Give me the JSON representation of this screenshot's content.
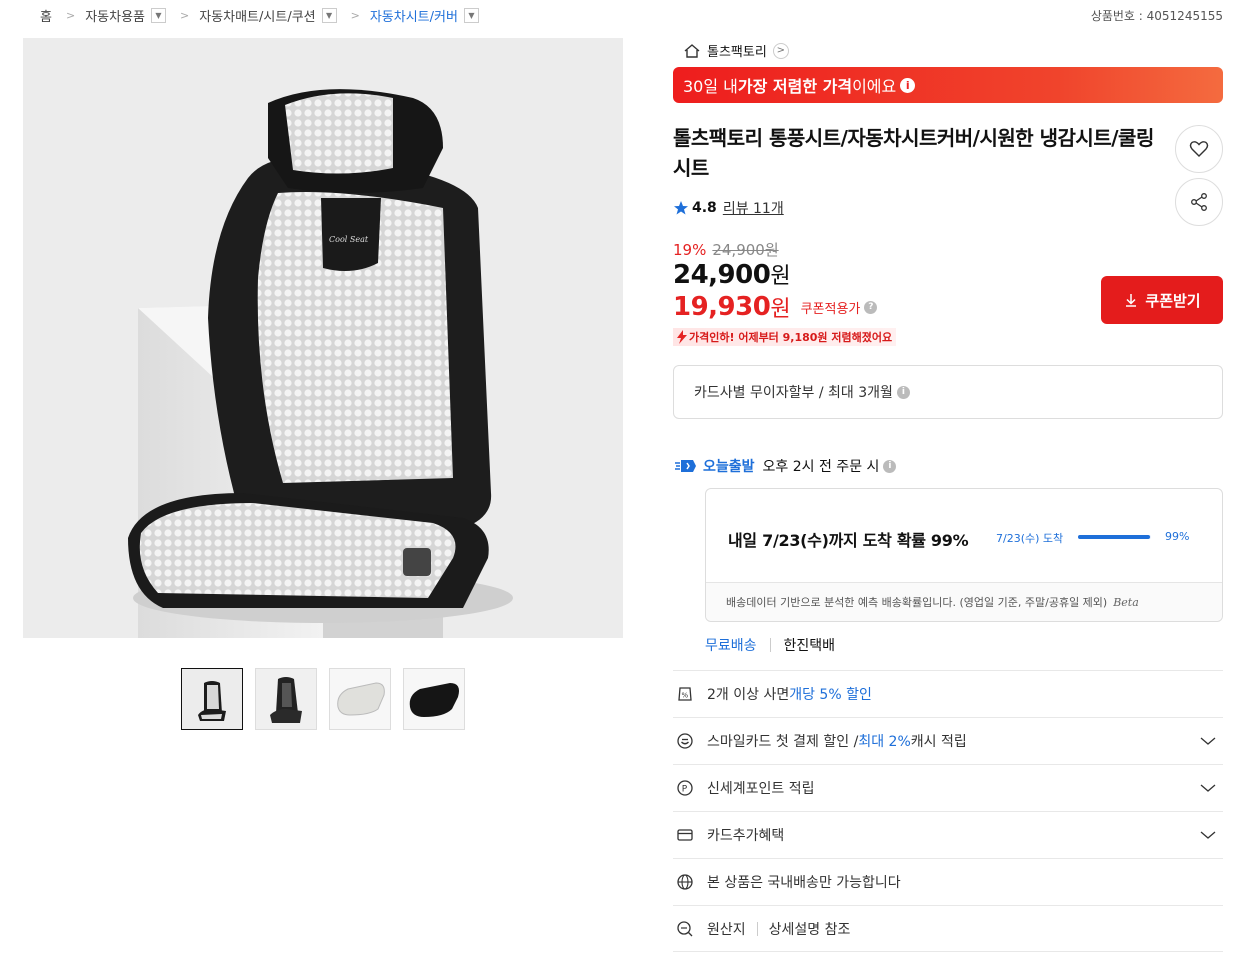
{
  "breadcrumb": {
    "home": "홈",
    "items": [
      {
        "label": "자동차용품"
      },
      {
        "label": "자동차매트/시트/쿠션"
      },
      {
        "label": "자동차시트/커버"
      }
    ]
  },
  "product_no": "상품번호 : 4051245155",
  "store": {
    "name": "톨츠팩토리"
  },
  "banner": {
    "prefix": "30일 내 ",
    "bold": "가장 저렴한 가격",
    "suffix": "이에요"
  },
  "title": "톨츠팩토리 통풍시트/자동차시트커버/시원한 냉감시트/쿨링시트",
  "rating": {
    "score": "4.8",
    "review_text": "리뷰 11개"
  },
  "price": {
    "discount_rate": "19%",
    "original": "24,900원",
    "sale_value": "24,900",
    "sale_unit": "원",
    "coupon_value": "19,930",
    "coupon_unit": "원",
    "coupon_label": "쿠폰적용가",
    "drop_text": "가격인하! 어제부터 9,180원 저렴해졌어요"
  },
  "coupon_button": "쿠폰받기",
  "installment": "카드사별 무이자할부 / 최대 3개월",
  "delivery": {
    "today_label": "오늘출발",
    "cutoff": "오후 2시 전 주문 시",
    "main_text": "내일 7/23(수)까지 도착 확률 99%",
    "arrive_label": "7/23(수) 도착",
    "probability": 0.99,
    "probability_text": "99%",
    "note": "배송데이터 기반으로 분석한 예측 배송확률입니다. (영업일 기준, 주말/공휴일 제외)",
    "beta": "Beta"
  },
  "shipping": {
    "free": "무료배송",
    "carrier": "한진택배"
  },
  "benefits": [
    {
      "pre": "2개 이상 사면 ",
      "blue": "개당 5% 할인",
      "post": ""
    },
    {
      "pre": "스마일카드 첫 결제 할인 / ",
      "blue": "최대 2%",
      "post": " 캐시 적립"
    },
    {
      "pre": "신세계포인트 적립",
      "blue": "",
      "post": ""
    },
    {
      "pre": "카드추가혜택",
      "blue": "",
      "post": ""
    },
    {
      "pre": "본 상품은 국내배송만 가능합니다",
      "blue": "",
      "post": ""
    }
  ],
  "origin": {
    "label": "원산지",
    "value": "상세설명 참조"
  },
  "colors": {
    "accent_red": "#e41c1c",
    "accent_blue": "#1e6fd9"
  }
}
